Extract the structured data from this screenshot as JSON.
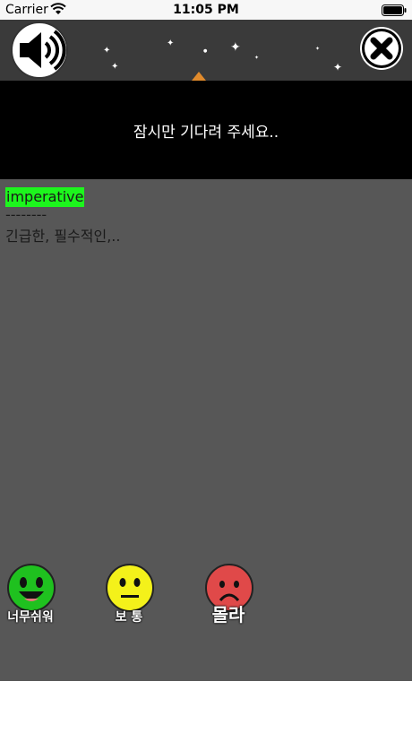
{
  "status_bar": {
    "carrier": "Carrier",
    "time": "11:05 PM"
  },
  "header": {
    "sound_icon": "speaker-volume-icon",
    "close_icon": "close-x-icon"
  },
  "loading_banner": {
    "text": "잠시만 기다려 주세요.."
  },
  "card": {
    "word": "imperative",
    "divider": "--------",
    "meaning": "긴급한, 필수적인,.."
  },
  "rating_buttons": [
    {
      "label": "너무쉬워",
      "color": "#1fc11f",
      "icon": "laughing-face-icon"
    },
    {
      "label": "보 통",
      "color": "#f4f11a",
      "icon": "neutral-face-icon"
    },
    {
      "label": "몰라",
      "color": "#e04949",
      "icon": "sad-face-icon"
    }
  ],
  "colors": {
    "highlight": "#1df51d",
    "card_bg": "#575757",
    "banner_bg": "#000000"
  }
}
